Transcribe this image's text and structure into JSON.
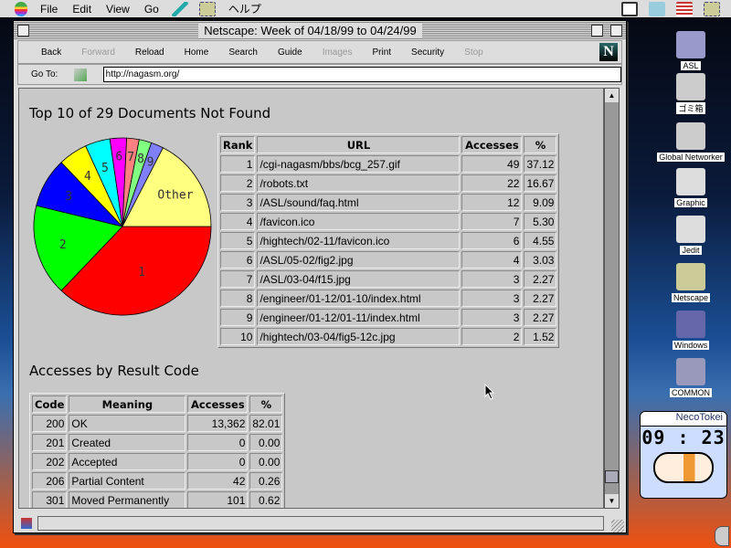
{
  "menubar": {
    "items": [
      "File",
      "Edit",
      "View",
      "Go",
      "ヘルプ"
    ]
  },
  "window": {
    "title": "Netscape: Week of 04/18/99 to 04/24/99"
  },
  "toolbar": {
    "buttons": [
      "Back",
      "Forward",
      "Reload",
      "Home",
      "Search",
      "Guide",
      "Images",
      "Print",
      "Security",
      "Stop"
    ],
    "disabled": [
      false,
      true,
      false,
      false,
      false,
      false,
      true,
      false,
      false,
      true
    ]
  },
  "location": {
    "label": "Go To:",
    "url": "http://nagasm.org/"
  },
  "section1": {
    "title": "Top 10 of 29 Documents Not Found"
  },
  "section2": {
    "title": "Accesses by Result Code"
  },
  "chart_data": {
    "type": "pie",
    "title": "Top 10 of 29 Documents Not Found",
    "labels": [
      "1",
      "2",
      "3",
      "4",
      "5",
      "6",
      "7",
      "8",
      "9",
      "Other"
    ],
    "values": [
      37.12,
      16.67,
      9.09,
      5.3,
      4.55,
      3.03,
      2.27,
      2.27,
      2.27,
      17.43
    ],
    "colors": [
      "#ff0000",
      "#00ff00",
      "#0000ff",
      "#ffff00",
      "#00ffff",
      "#ff00ff",
      "#ff8080",
      "#80ff80",
      "#8080ff",
      "#ffff80"
    ]
  },
  "not_found_table": {
    "headers": [
      "Rank",
      "URL",
      "Accesses",
      "%"
    ],
    "rows": [
      [
        "1",
        "/cgi-nagasm/bbs/bcg_257.gif",
        "49",
        "37.12"
      ],
      [
        "2",
        "/robots.txt",
        "22",
        "16.67"
      ],
      [
        "3",
        "/ASL/sound/faq.html",
        "12",
        "9.09"
      ],
      [
        "4",
        "/favicon.ico",
        "7",
        "5.30"
      ],
      [
        "5",
        "/hightech/02-11/favicon.ico",
        "6",
        "4.55"
      ],
      [
        "6",
        "/ASL/05-02/fig2.jpg",
        "4",
        "3.03"
      ],
      [
        "7",
        "/ASL/03-04/f15.jpg",
        "3",
        "2.27"
      ],
      [
        "8",
        "/engineer/01-12/01-10/index.html",
        "3",
        "2.27"
      ],
      [
        "9",
        "/engineer/01-12/01-11/index.html",
        "3",
        "2.27"
      ],
      [
        "10",
        "/hightech/03-04/fig5-12c.jpg",
        "2",
        "1.52"
      ]
    ]
  },
  "result_table": {
    "headers": [
      "Code",
      "Meaning",
      "Accesses",
      "%"
    ],
    "rows": [
      [
        "200",
        "OK",
        "13,362",
        "82.01"
      ],
      [
        "201",
        "Created",
        "0",
        "0.00"
      ],
      [
        "202",
        "Accepted",
        "0",
        "0.00"
      ],
      [
        "206",
        "Partial Content",
        "42",
        "0.26"
      ],
      [
        "301",
        "Moved Permanently",
        "101",
        "0.62"
      ]
    ]
  },
  "desktop": {
    "icons": [
      "ASL",
      "ゴミ箱",
      "Global Networker",
      "Graphic",
      "Jedit",
      "Netscape",
      "Windows",
      "COMMON"
    ]
  },
  "clock": {
    "title": "NecoTokei",
    "time": "09 : 23"
  }
}
